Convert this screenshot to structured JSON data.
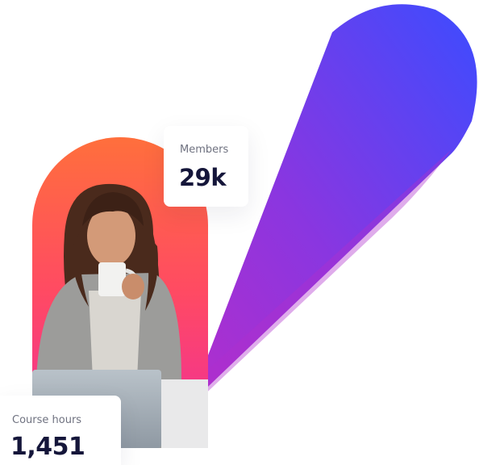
{
  "stats": {
    "members": {
      "label": "Members",
      "value": "29k"
    },
    "course_hours": {
      "label": "Course hours",
      "value": "1,451"
    }
  },
  "colors": {
    "ribbon_start": "#a12fd2",
    "ribbon_end": "#3f4dff",
    "photo_gradient_top": "#ff6b3d",
    "photo_gradient_bottom": "#ee2f9a",
    "value_text": "#15163a",
    "label_text": "#6f7280"
  },
  "image": {
    "description_icon": "woman-with-laptop-photo-icon"
  }
}
